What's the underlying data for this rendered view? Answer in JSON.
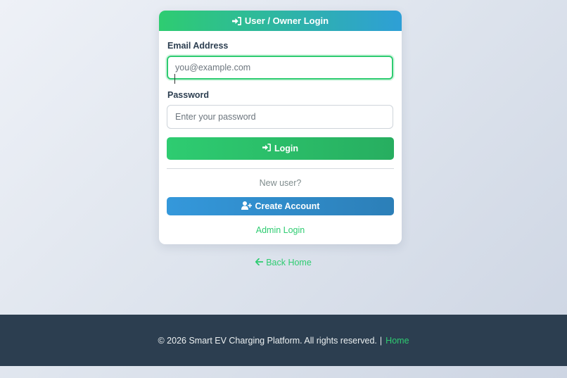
{
  "login_card": {
    "title": "User / Owner Login",
    "title_icon": "sign-in-icon",
    "email": {
      "label": "Email Address",
      "placeholder": "you@example.com",
      "value": ""
    },
    "password": {
      "label": "Password",
      "placeholder": "Enter your password",
      "value": ""
    },
    "login_button": {
      "label": "Login",
      "icon": "sign-in-icon"
    },
    "new_user_text": "New user?",
    "create_account_button": {
      "label": "Create Account",
      "icon": "user-plus-icon"
    },
    "admin_login_link": "Admin Login"
  },
  "back_home_link": {
    "label": "Back Home",
    "icon": "arrow-left-icon"
  },
  "footer": {
    "copyright": "© 2026 Smart EV Charging Platform. All rights reserved.",
    "separator": "|",
    "home_link": "Home"
  },
  "colors": {
    "accent_green": "#2ecc71",
    "accent_blue": "#3498db",
    "footer_bg": "#2c3e50"
  }
}
